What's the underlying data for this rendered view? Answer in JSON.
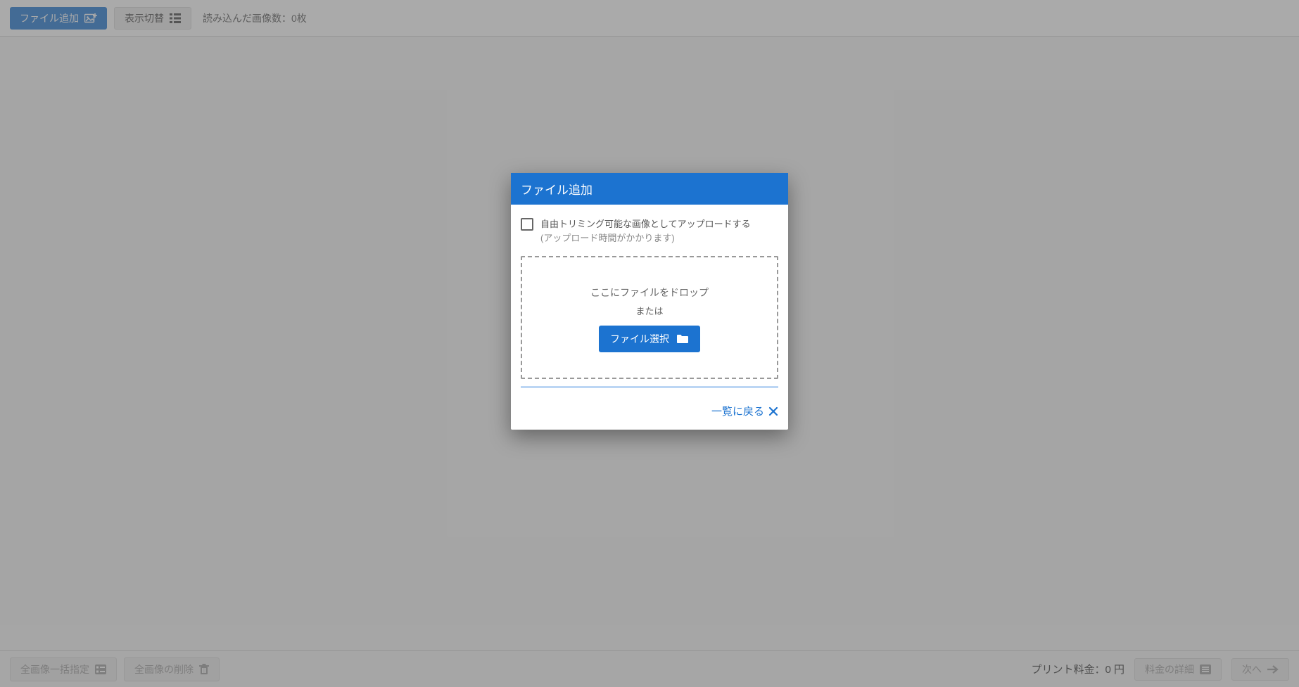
{
  "topbar": {
    "add_file_label": "ファイル追加",
    "toggle_view_label": "表示切替",
    "loaded_count_label": "読み込んだ画像数：0枚"
  },
  "bottombar": {
    "batch_select_label": "全画像一括指定",
    "delete_all_label": "全画像の削除",
    "price_label": "プリント料金：0 円",
    "price_detail_label": "料金の詳細",
    "next_label": "次へ"
  },
  "modal": {
    "title": "ファイル追加",
    "checkbox_line1": "自由トリミング可能な画像としてアップロードする",
    "checkbox_line2": "(アップロード時間がかかります)",
    "drop_label": "ここにファイルをドロップ",
    "or_label": "または",
    "file_select_label": "ファイル選択",
    "back_label": "一覧に戻る"
  },
  "colors": {
    "primary": "#1c73d0"
  }
}
